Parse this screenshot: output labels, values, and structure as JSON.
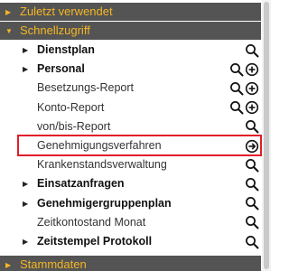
{
  "sections": {
    "recent": {
      "label": "Zuletzt verwendet",
      "expanded": false
    },
    "quick": {
      "label": "Schnellzugriff",
      "expanded": true
    },
    "master": {
      "label": "Stammdaten",
      "expanded": false
    }
  },
  "items": [
    {
      "label": "Dienstplan",
      "bold": true,
      "expandable": true,
      "icons": [
        "search-icon"
      ]
    },
    {
      "label": "Personal",
      "bold": true,
      "expandable": true,
      "icons": [
        "search-icon",
        "add-icon"
      ]
    },
    {
      "label": "Besetzungs-Report",
      "bold": false,
      "expandable": false,
      "icons": [
        "search-icon",
        "add-icon"
      ]
    },
    {
      "label": "Konto-Report",
      "bold": false,
      "expandable": false,
      "icons": [
        "search-icon",
        "add-icon"
      ]
    },
    {
      "label": "von/bis-Report",
      "bold": false,
      "expandable": false,
      "icons": [
        "search-icon"
      ]
    },
    {
      "label": "Genehmigungsverfahren",
      "bold": false,
      "expandable": false,
      "icons": [
        "arrow-right-circle-icon"
      ],
      "highlighted": true
    },
    {
      "label": "Krankenstandsverwaltung",
      "bold": false,
      "expandable": false,
      "icons": [
        "search-icon"
      ]
    },
    {
      "label": "Einsatzanfragen",
      "bold": true,
      "expandable": true,
      "icons": [
        "search-icon"
      ]
    },
    {
      "label": "Genehmigergruppenplan",
      "bold": true,
      "expandable": true,
      "icons": [
        "search-icon"
      ]
    },
    {
      "label": "Zeitkontostand Monat",
      "bold": false,
      "expandable": false,
      "icons": [
        "search-icon"
      ]
    },
    {
      "label": "Zeitstempel Protokoll",
      "bold": true,
      "expandable": true,
      "icons": [
        "search-icon"
      ]
    }
  ],
  "colors": {
    "header_bg": "#545454",
    "header_text": "#f5b624",
    "highlight": "#e11d2a"
  }
}
